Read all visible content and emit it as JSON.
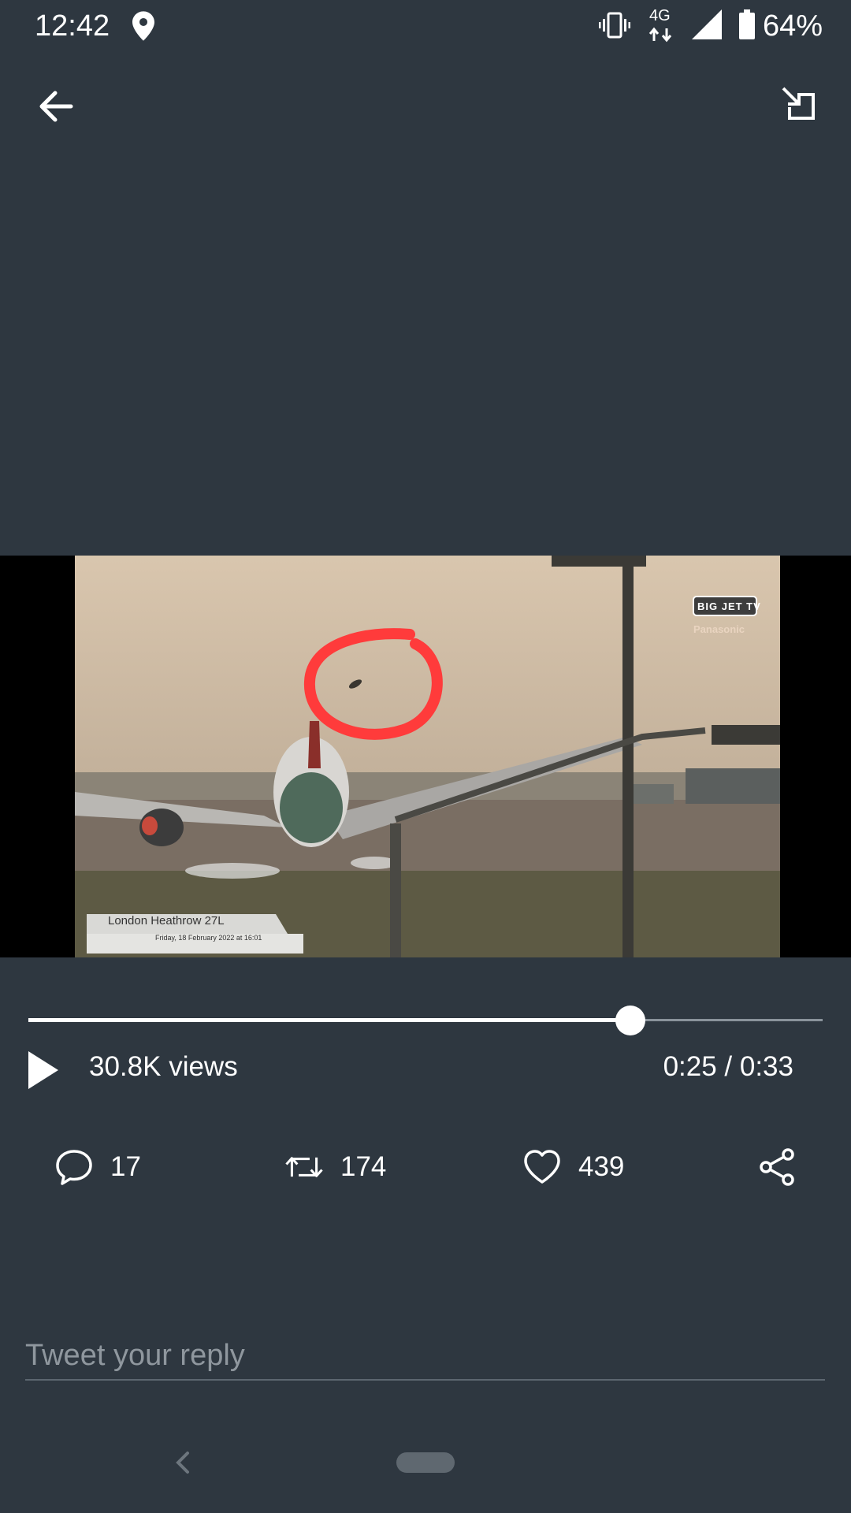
{
  "status_bar": {
    "time": "12:42",
    "network_type": "4G",
    "battery": "64%",
    "icons": [
      "location-icon",
      "vibrate-icon",
      "network-arrows-icon",
      "signal-icon",
      "battery-icon"
    ]
  },
  "toolbar": {
    "back_icon": "arrow-left-icon",
    "minimize_icon": "picture-in-picture-icon"
  },
  "video": {
    "caption_title": "London Heathrow 27L",
    "caption_date": "Friday, 18 February 2022 at 16:01",
    "watermark_line1": "BIG JET TV",
    "watermark_line2": "Panasonic",
    "progress": 0.758
  },
  "player": {
    "views": "30.8K views",
    "time": "0:25 / 0:33",
    "play_icon": "play-icon"
  },
  "actions": {
    "reply_count": "17",
    "retweet_count": "174",
    "like_count": "439",
    "share_icon": "share-icon"
  },
  "reply_box": {
    "placeholder": "Tweet your reply"
  },
  "colors": {
    "background": "#2e3740",
    "foreground": "#ffffff",
    "annotation_circle": "#ff3b3b"
  }
}
